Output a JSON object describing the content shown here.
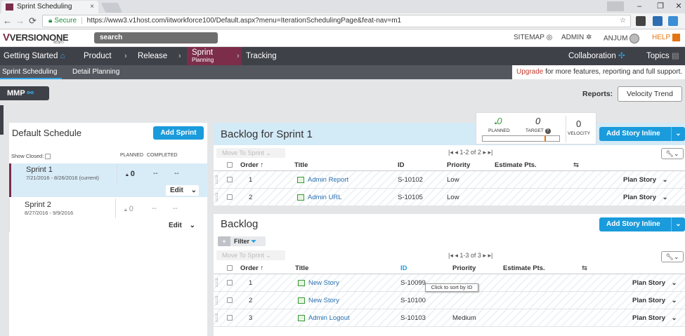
{
  "browser": {
    "tab_title": "Sprint Scheduling",
    "tab_close": "×",
    "secure_label": "Secure",
    "url": "https://www3.v1host.com/iitworkforce100/Default.aspx?menu=IterationSchedulingPage&feat-nav=m1",
    "minimize": "–",
    "maximize": "❐",
    "close": "✕"
  },
  "header": {
    "logo": "VERSIONONE",
    "logo_sub": "team",
    "search_label": "search",
    "links": [
      "SITEMAP",
      "ADMIN",
      "ANJUM",
      "HELP"
    ]
  },
  "nav": {
    "items": [
      "Getting Started",
      "Product",
      "Release",
      "Sprint",
      "Planning",
      "Tracking",
      "Collaboration",
      "Topics"
    ]
  },
  "subnav": {
    "items": [
      "Sprint Scheduling",
      "Detail Planning"
    ],
    "upgrade_link": "Upgrade",
    "upgrade_text": " for more features, reporting and full support."
  },
  "toolbar": {
    "mmp": "MMP",
    "reports_label": "Reports:",
    "velocity_trend": "Velocity Trend"
  },
  "schedule": {
    "title": "Default Schedule",
    "add_sprint": "Add Sprint",
    "show_closed": "Show Closed:",
    "planned_col": "PLANNED",
    "completed_col": "COMPLETED",
    "sprints": [
      {
        "name": "Sprint 1",
        "dates": "7/21/2016 - 8/26/2016 (current)",
        "planned": "0",
        "c1": "--",
        "c2": "--",
        "edit": "Edit"
      },
      {
        "name": "Sprint 2",
        "dates": "8/27/2016 - 9/9/2016",
        "planned": "0",
        "c1": "--",
        "c2": "--",
        "edit": "Edit"
      }
    ]
  },
  "stats": {
    "planned_value": "0",
    "planned_label": "PLANNED",
    "target_value": "0",
    "target_label": "TARGET",
    "velocity_value": "0",
    "velocity_label": "VELOCITY"
  },
  "sprint_backlog": {
    "title": "Backlog for Sprint 1",
    "add_story": "Add Story Inline",
    "move_to_sprint": "Move To Sprint",
    "pager": "1-2 of 2",
    "columns": [
      "Order",
      "Title",
      "ID",
      "Priority",
      "Estimate Pts."
    ],
    "rows": [
      {
        "order": "1",
        "title": "Admin Report",
        "id": "S-10102",
        "priority": "Low",
        "estimate": "",
        "action": "Plan Story"
      },
      {
        "order": "2",
        "title": "Admin URL",
        "id": "S-10105",
        "priority": "Low",
        "estimate": "",
        "action": "Plan Story"
      }
    ]
  },
  "backlog": {
    "title": "Backlog",
    "add_story": "Add Story Inline",
    "filter": "Filter",
    "move_to_sprint": "Move To Sprint",
    "pager": "1-3 of 3",
    "columns": [
      "Order",
      "Title",
      "ID",
      "Priority",
      "Estimate Pts."
    ],
    "rows": [
      {
        "order": "1",
        "title": "New Story",
        "id": "S-10099",
        "priority": "",
        "estimate": "",
        "action": "Plan Story"
      },
      {
        "order": "2",
        "title": "New Story",
        "id": "S-10100",
        "priority": "",
        "estimate": "",
        "action": "Plan Story"
      },
      {
        "order": "3",
        "title": "Admin Logout",
        "id": "S-10103",
        "priority": "Medium",
        "estimate": "",
        "action": "Plan Story"
      }
    ],
    "tooltip": "Click to sort by ID"
  },
  "colors": {
    "brand": "#7b2d4a",
    "accent_blue": "#1a9bdc",
    "nav_dark": "#3f4148",
    "help_orange": "#e27512"
  }
}
